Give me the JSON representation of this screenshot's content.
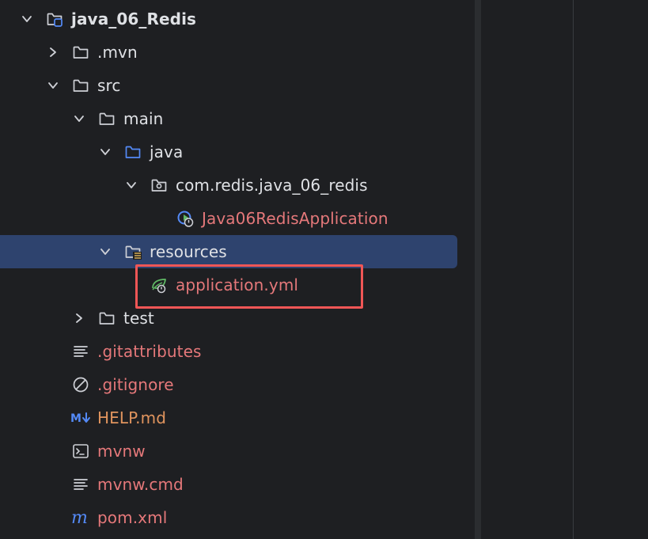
{
  "colors": {
    "background": "#1e1f22",
    "selection": "#2e436e",
    "text": "#dfe1e5",
    "untracked": "#e5787a",
    "modified": "#e0945e",
    "folder_stroke": "#ced0d6",
    "source_folder": "#548af7",
    "highlight": "#f05656"
  },
  "tree": {
    "items": [
      {
        "label": "java_06_Redis",
        "icon": "project-folder-icon",
        "expanded": true
      },
      {
        "label": ".mvn",
        "icon": "folder-icon",
        "expanded": false
      },
      {
        "label": "src",
        "icon": "folder-icon",
        "expanded": true
      },
      {
        "label": "main",
        "icon": "folder-icon",
        "expanded": true
      },
      {
        "label": "java",
        "icon": "source-folder-icon",
        "expanded": true
      },
      {
        "label": "com.redis.java_06_redis",
        "icon": "package-icon",
        "expanded": true
      },
      {
        "label": "Java06RedisApplication",
        "icon": "spring-boot-class-icon",
        "status": "untracked"
      },
      {
        "label": "resources",
        "icon": "resources-folder-icon",
        "expanded": true,
        "selected": true
      },
      {
        "label": "application.yml",
        "icon": "spring-config-icon",
        "status": "untracked",
        "highlighted": true
      },
      {
        "label": "test",
        "icon": "folder-icon",
        "expanded": false
      },
      {
        "label": ".gitattributes",
        "icon": "text-file-icon",
        "status": "untracked"
      },
      {
        "label": ".gitignore",
        "icon": "ignore-file-icon",
        "status": "untracked"
      },
      {
        "label": "HELP.md",
        "icon": "markdown-icon",
        "status": "modified"
      },
      {
        "label": "mvnw",
        "icon": "shell-script-icon",
        "status": "untracked"
      },
      {
        "label": "mvnw.cmd",
        "icon": "text-file-icon",
        "status": "untracked"
      },
      {
        "label": "pom.xml",
        "icon": "maven-icon",
        "status": "untracked"
      }
    ]
  }
}
